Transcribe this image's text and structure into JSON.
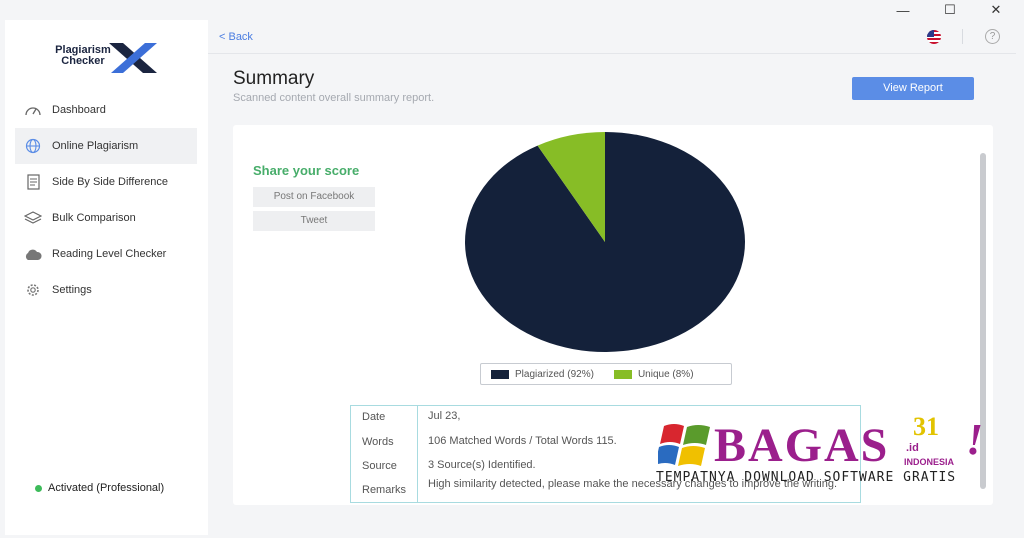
{
  "window": {
    "controls": {
      "minimize": "—",
      "maximize": "☐",
      "close": "✕"
    }
  },
  "sidebar": {
    "logo": {
      "line1": "Plagiarism",
      "line2": "Checker",
      "mark": "X"
    },
    "items": [
      {
        "label": "Dashboard",
        "icon": "gauge-icon",
        "active": false
      },
      {
        "label": "Online Plagiarism",
        "icon": "globe-icon",
        "active": true
      },
      {
        "label": "Side By Side Difference",
        "icon": "document-icon",
        "active": false
      },
      {
        "label": "Bulk Comparison",
        "icon": "layers-icon",
        "active": false
      },
      {
        "label": "Reading Level Checker",
        "icon": "cloud-icon",
        "active": false
      },
      {
        "label": "Settings",
        "icon": "gear-icon",
        "active": false
      }
    ],
    "status": "Activated (Professional)"
  },
  "topbar": {
    "back": "< Back"
  },
  "header": {
    "title": "Summary",
    "subtitle": "Scanned content overall summary report.",
    "view_report": "View Report"
  },
  "share": {
    "title": "Share your score",
    "facebook": "Post on Facebook",
    "tweet": "Tweet"
  },
  "chart_data": {
    "type": "pie",
    "slices": [
      {
        "name": "Plagiarized",
        "value": 92,
        "color": "#14213a"
      },
      {
        "name": "Unique",
        "value": 8,
        "color": "#87bd26"
      }
    ],
    "legend": [
      "Plagiarized (92%)",
      "Unique (8%)"
    ],
    "legend_position": "bottom"
  },
  "info": {
    "rows": [
      {
        "key": "Date",
        "value": "Jul 23,"
      },
      {
        "key": "Words",
        "value": "106 Matched Words / Total Words 115."
      },
      {
        "key": "Source",
        "value": "3 Source(s) Identified."
      },
      {
        "key": "Remarks",
        "value": "High similarity detected, please make the necessary changes to improve the writing."
      }
    ]
  },
  "watermark": {
    "brand": "BAGAS",
    "number": "31",
    "suffix": ".id",
    "country": "INDONESIA",
    "bang": "!",
    "tagline": "TEMPATNYA DOWNLOAD SOFTWARE GRATIS"
  },
  "colors": {
    "accent": "#5b8de6",
    "share_green": "#47ad6a",
    "plagiarized": "#14213a",
    "unique": "#87bd26",
    "status_green": "#3dbb5a"
  }
}
